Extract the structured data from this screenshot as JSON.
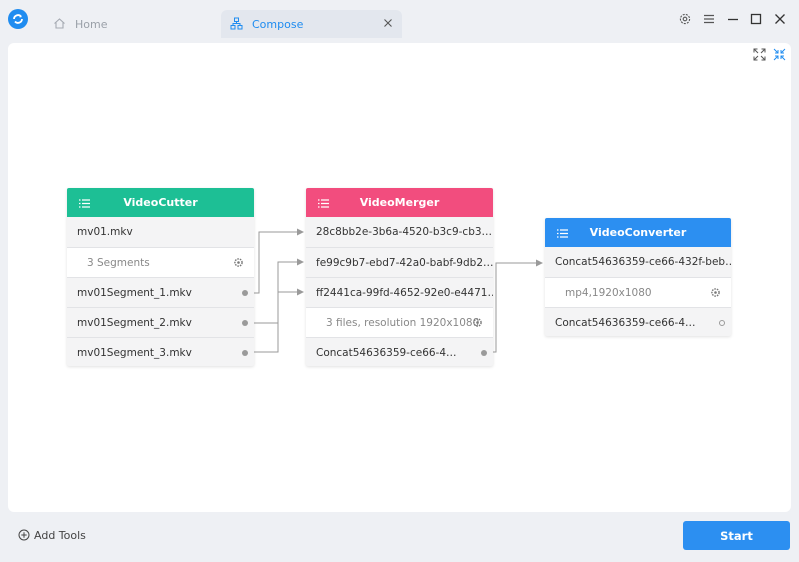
{
  "tabs": [
    {
      "label": "Home"
    },
    {
      "label": "Compose"
    }
  ],
  "colors": {
    "cutter": "#1dbf95",
    "merger": "#f24d7e",
    "converter": "#2c8ff1",
    "accent": "#1f8cf0"
  },
  "icons": {
    "logo": "app-logo-icon",
    "home": "home-icon",
    "compose": "flow-icon",
    "close": "close-icon",
    "settings": "gear-icon",
    "menu": "hamburger-icon",
    "minimize": "minimize-icon",
    "maximize": "maximize-icon",
    "window_close": "close-icon",
    "expand": "expand-icon",
    "collapse": "collapse-icon",
    "list": "list-icon",
    "add": "plus-circle-icon"
  },
  "nodes": {
    "cutter": {
      "title": "VideoCutter",
      "input": "mv01.mkv",
      "info": "3 Segments",
      "outputs": [
        "mv01Segment_1.mkv",
        "mv01Segment_2.mkv",
        "mv01Segment_3.mkv"
      ]
    },
    "merger": {
      "title": "VideoMerger",
      "inputs": [
        "28c8bb2e-3b6a-4520-b3c9-cb3…",
        "fe99c9b7-ebd7-42a0-babf-9db2…",
        "ff2441ca-99fd-4652-92e0-e4471…"
      ],
      "info": "3 files, resolution 1920x1080",
      "output": "Concat54636359-ce66-4…"
    },
    "converter": {
      "title": "VideoConverter",
      "input": "Concat54636359-ce66-432f-beb…",
      "info": "mp4,1920x1080",
      "output": "Concat54636359-ce66-4…"
    }
  },
  "footer": {
    "add_tools": "Add Tools",
    "start": "Start"
  }
}
